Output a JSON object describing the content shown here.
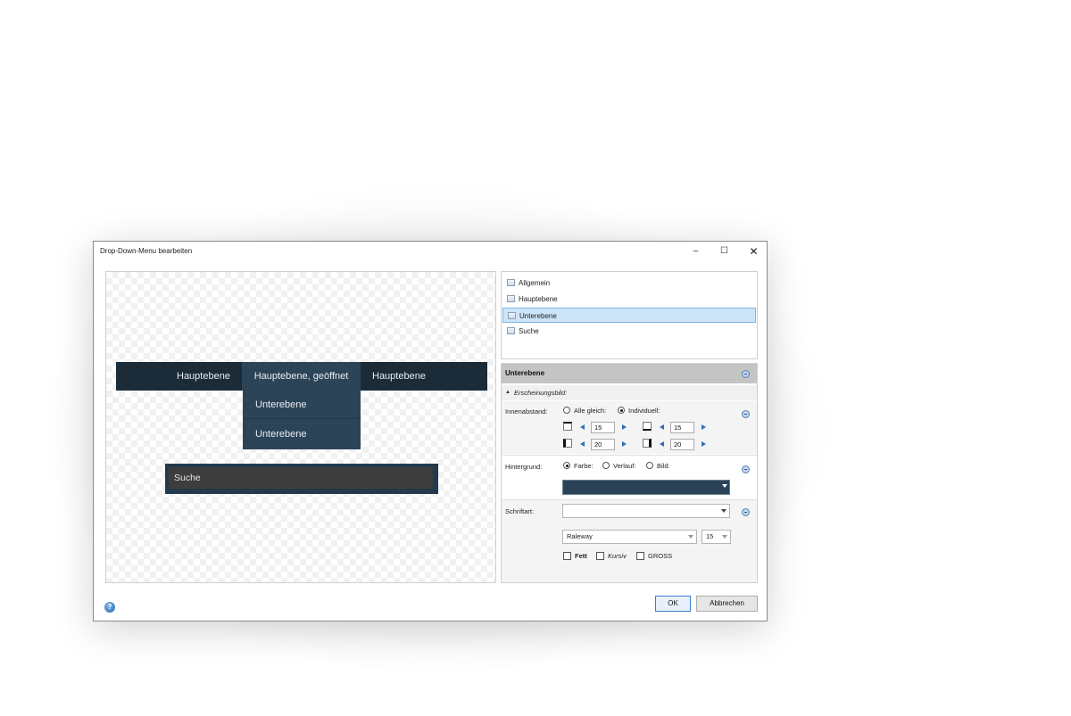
{
  "window": {
    "title": "Drop-Down-Menu bearbeiten",
    "minimize": "–",
    "maximize": "☐",
    "close": "✕"
  },
  "preview": {
    "menu_items": [
      "Hauptebene",
      "Hauptebene, geöffnet",
      "Hauptebene"
    ],
    "submenu_items": [
      "Unterebene",
      "Unterebene"
    ],
    "search_text": "Suche",
    "colors": {
      "menubar": "#1b2b38",
      "open_item": "#2c4458",
      "search_field": "#3d3d3d"
    }
  },
  "nav": {
    "items": [
      "Allgemein",
      "Hauptebene",
      "Unterebene",
      "Suche"
    ],
    "selected_index": 2
  },
  "props": {
    "header": "Unterebene",
    "section": "Erscheinungsbild:",
    "padding": {
      "label": "Innenabstand:",
      "option_all": "Alle gleich:",
      "option_individual": "Individuell:",
      "selected": "Individuell:",
      "top": "15",
      "bottom": "15",
      "left": "20",
      "right": "20"
    },
    "background": {
      "label": "Hintergrund:",
      "option_color": "Farbe:",
      "option_gradient": "Verlauf:",
      "option_image": "Bild:",
      "selected": "Farbe:",
      "color": "#2a4257"
    },
    "font": {
      "label": "Schriftart:",
      "preset": "",
      "family": "Raleway",
      "size": "15",
      "bold": "Fett",
      "italic": "Kursiv",
      "upper": "GROSS",
      "bold_checked": false,
      "italic_checked": false,
      "upper_checked": false
    }
  },
  "footer": {
    "help_icon": "?",
    "ok": "OK",
    "cancel": "Abbrechen"
  }
}
